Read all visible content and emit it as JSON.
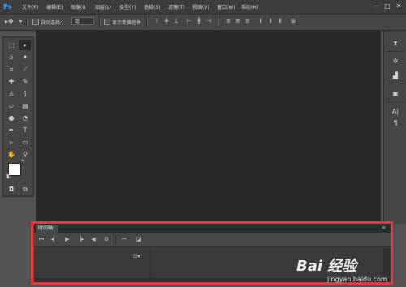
{
  "app": {
    "logo": "Ps"
  },
  "menu": [
    "文件(F)",
    "编辑(E)",
    "图像(I)",
    "图层(L)",
    "类型(Y)",
    "选择(S)",
    "滤镜(T)",
    "视图(V)",
    "窗口(W)",
    "帮助(H)"
  ],
  "window_controls": {
    "minimize": "—",
    "maximize": "□",
    "close": "✕"
  },
  "options_bar": {
    "auto_select_label": "自动选择：",
    "auto_select_value": "组",
    "show_transform_label": "显示变换控件"
  },
  "timeline": {
    "tab_label": "时间轴",
    "menu_glyph": "☷▾"
  },
  "watermark": {
    "brand": "Bai 经验",
    "site": "jingyan.baidu.com"
  }
}
